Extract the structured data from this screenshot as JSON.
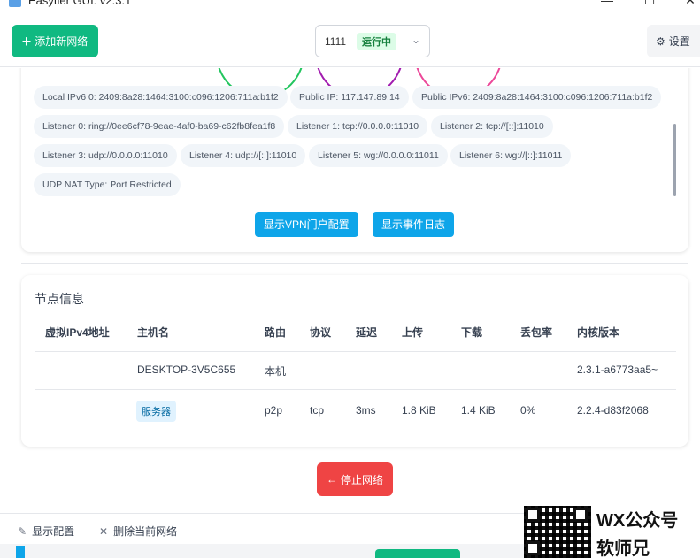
{
  "window": {
    "title": "Easytier GUI: v2.3.1",
    "minimize": "—",
    "maximize": "☐",
    "close": "✕"
  },
  "toolbar": {
    "add_network_label": "添加新网络",
    "network_select": {
      "value": "1111",
      "status": "运行中"
    },
    "settings_label": "设置"
  },
  "node_info_chips": [
    "Local IPv6 0: 2409:8a28:1464:3100:c096:1206:711a:b1f2",
    "Public IP: 117.147.89.14",
    "Public IPv6: 2409:8a28:1464:3100:c096:1206:711a:b1f2",
    "Listener 0: ring://0ee6cf78-9eae-4af0-ba69-c62fb8fea1f8",
    "Listener 1: tcp://0.0.0.0:11010",
    "Listener 2: tcp://[::]:11010",
    "Listener 3: udp://0.0.0.0:11010",
    "Listener 4: udp://[::]:11010",
    "Listener 5: wg://0.0.0.0:11011",
    "Listener 6: wg://[::]:11011",
    "UDP NAT Type: Port Restricted"
  ],
  "actions": {
    "vpn_portal_label": "显示VPN门户配置",
    "event_log_label": "显示事件日志"
  },
  "peers": {
    "heading": "节点信息",
    "columns": [
      "虚拟IPv4地址",
      "主机名",
      "路由",
      "协议",
      "延迟",
      "上传",
      "下载",
      "丢包率",
      "内核版本"
    ],
    "rows": [
      {
        "ipv4": "",
        "hostname": "DESKTOP-3V5C655",
        "route": "本机",
        "protocol": "",
        "latency": "",
        "upload": "",
        "download": "",
        "loss": "",
        "version": "2.3.1-a6773aa5~"
      },
      {
        "ipv4": "",
        "hostname": "服务器",
        "route": "p2p",
        "protocol": "tcp",
        "latency": "3ms",
        "upload": "1.8 KiB",
        "download": "1.4 KiB",
        "loss": "0%",
        "version": "2.2.4-d83f2068"
      }
    ]
  },
  "stop_network_label": "停止网络",
  "footer": {
    "show_config_label": "显示配置",
    "delete_network_label": "删除当前网络"
  },
  "watermark": {
    "line1": "WX公众号",
    "line2": "软师兄"
  },
  "colors": {
    "primary_green": "#10b981",
    "primary_blue": "#0ea5e9",
    "danger_red": "#ef4444",
    "running_badge_bg": "#dcfce7",
    "running_badge_text": "#15803d"
  }
}
